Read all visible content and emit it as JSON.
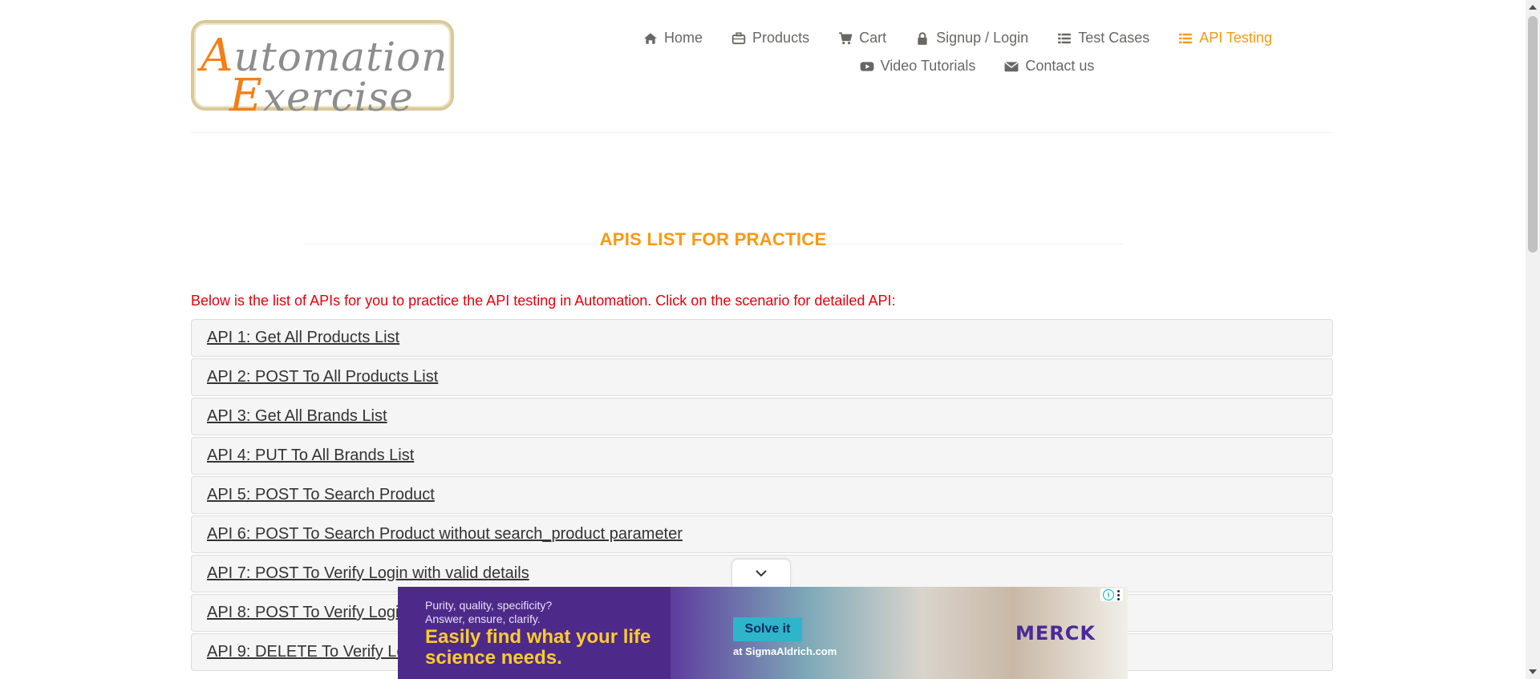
{
  "logo": {
    "line1_cap": "A",
    "line1_rest": "utomation",
    "line2_cap": "E",
    "line2_rest": "xercise"
  },
  "nav": {
    "row1": [
      {
        "label": "Home",
        "icon": "home-icon"
      },
      {
        "label": "Products",
        "icon": "briefcase-icon"
      },
      {
        "label": "Cart",
        "icon": "cart-icon"
      },
      {
        "label": "Signup / Login",
        "icon": "lock-icon"
      },
      {
        "label": "Test Cases",
        "icon": "list-icon"
      },
      {
        "label": "API Testing",
        "icon": "list-icon",
        "active": true
      }
    ],
    "row2": [
      {
        "label": "Video Tutorials",
        "icon": "youtube-play-icon"
      },
      {
        "label": "Contact us",
        "icon": "envelope-icon"
      }
    ]
  },
  "page": {
    "title": "APIS LIST FOR PRACTICE",
    "intro": "Below is the list of APIs for you to practice the API testing in Automation. Click on the scenario for detailed API:"
  },
  "apis": [
    "API 1: Get All Products List",
    "API 2: POST To All Products List",
    "API 3: Get All Brands List",
    "API 4: PUT To All Brands List",
    "API 5: POST To Search Product",
    "API 6: POST To Search Product without search_product parameter",
    "API 7: POST To Verify Login with valid details",
    "API 8: POST To Verify Login without email parameter",
    "API 9: DELETE To Verify Login"
  ],
  "ad": {
    "line1": "Purity, quality, specificity?",
    "line2": "Answer, ensure, clarify.",
    "headline": "Easily find what your life science needs.",
    "cta": "Solve it",
    "cta_sub": "at SigmaAldrich.com",
    "brand": "MERCK"
  },
  "colors": {
    "accent": "#fe980f",
    "intro_text": "#e5000b",
    "nav_text": "#696763"
  }
}
